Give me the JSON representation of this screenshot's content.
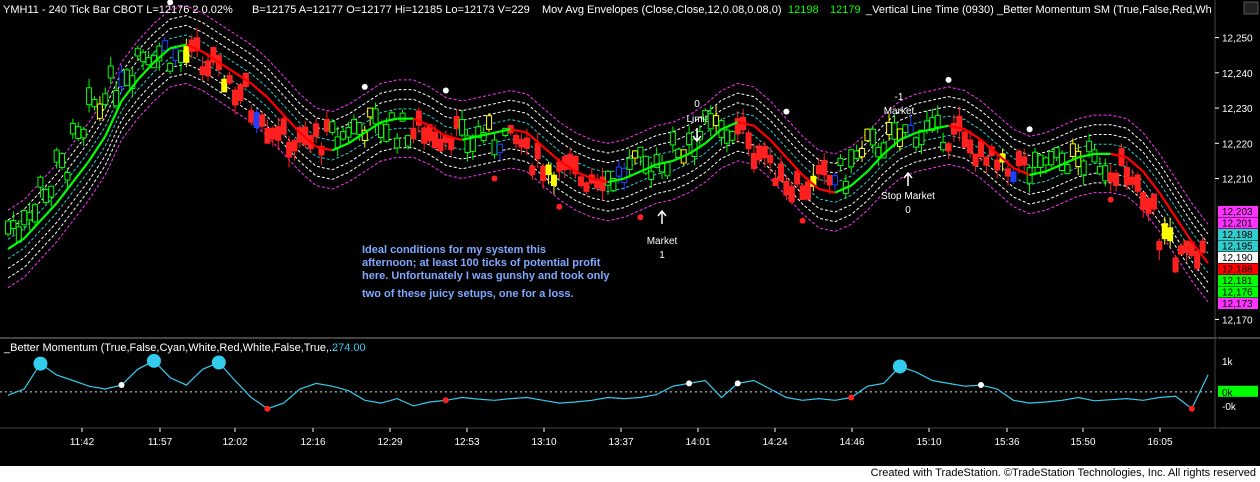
{
  "colors": {
    "background": "#000000",
    "up_candle": "#00ff00",
    "down_candle": "#ff2020",
    "yellow_candle": "#ffff00",
    "blue_candle": "#2040ff",
    "envelope_outer": "#ff33ff",
    "envelope_inner": "#ffffff",
    "envelope_mid": "#33cccc",
    "ma_up": "#00ff00",
    "ma_down": "#ff0000",
    "momentum": "#33ccee",
    "annotation": "#7fa9ff"
  },
  "header": {
    "symbol": "YMH11 - 240 Tick Bar  CBOT  L=12176  2   0.02%",
    "quote": "B=12175  A=12177  O=12177  Hi=12185  Lo=12173  V=229",
    "indicator": "Mov Avg Envelopes (Close,Close,12,0.08,0.08,0)",
    "ind_value_1": "12198",
    "ind_value_2": "12179",
    "vertical_line": "_Vertical Line Time (0930)",
    "momentum_sm": "_Better Momentum SM (True,False,Red,Wh"
  },
  "subpanel": {
    "title": "_Better Momentum (True,False,Cyan,White,Red,White,False,True,...",
    "value": "274.00",
    "axis_labels": [
      "1k",
      "0k",
      "-0k"
    ]
  },
  "price_axis": {
    "labels": [
      "12,250",
      "12,240",
      "12,230",
      "12,220",
      "12,210",
      "12,170"
    ],
    "tags": [
      {
        "text": "12,203",
        "color": "#ff33ff"
      },
      {
        "text": "12,201",
        "color": "#ff33ff"
      },
      {
        "text": "12,198",
        "color": "#33cccc"
      },
      {
        "text": "12,195",
        "color": "#33cccc"
      },
      {
        "text": "12,190",
        "color": "#ffffff"
      },
      {
        "text": "12,188",
        "color": "#ff0000"
      },
      {
        "text": "12,181",
        "color": "#00ff00"
      },
      {
        "text": "12,176",
        "color": "#00ff00"
      },
      {
        "text": "12,173",
        "color": "#ff33ff"
      }
    ]
  },
  "annotations": {
    "note_lines": [
      "Ideal conditions for my system this",
      "afternoon; at least 100 ticks of potential profit",
      "here. Unfortunately I was gunshy and took only",
      "two of these juicy setups, one for a loss."
    ],
    "market1": [
      "Market",
      "1"
    ],
    "limit0": [
      "0",
      "Limit"
    ],
    "market_minus1": [
      "-1",
      "Market"
    ],
    "stop_market": [
      "Stop Market",
      "0"
    ]
  },
  "footer": "Created with TradeStation. ©TradeStation Technologies, Inc. All rights reserved",
  "chart_data": {
    "type": "line",
    "x_labels": [
      "11:42",
      "11:57",
      "12:02",
      "12:16",
      "12:29",
      "12:53",
      "13:10",
      "13:37",
      "14:01",
      "14:24",
      "14:46",
      "15:10",
      "15:36",
      "15:50",
      "16:05"
    ],
    "ylim": [
      12167,
      12255
    ],
    "series": [
      {
        "name": "Mov Avg Envelopes",
        "values": [
          12190,
          12193,
          12198,
          12203,
          12209,
          12215,
          12222,
          12232,
          12238,
          12243,
          12247,
          12248,
          12246,
          12243,
          12240,
          12237,
          12233,
          12228,
          12223,
          12219,
          12218,
          12220,
          12223,
          12226,
          12227,
          12227,
          12225,
          12222,
          12221,
          12222,
          12223,
          12224,
          12223,
          12219,
          12215,
          12212,
          12210,
          12209,
          12210,
          12212,
          12214,
          12215,
          12217,
          12220,
          12224,
          12226,
          12225,
          12221,
          12216,
          12211,
          12207,
          12206,
          12208,
          12212,
          12217,
          12221,
          12223,
          12224,
          12225,
          12224,
          12221,
          12217,
          12213,
          12211,
          12212,
          12214,
          12216,
          12217,
          12217,
          12216,
          12212,
          12206,
          12199,
          12192,
          12186
        ]
      }
    ],
    "momentum_values": [
      -60,
      50,
      500,
      300,
      200,
      100,
      50,
      120,
      400,
      550,
      250,
      120,
      400,
      520,
      200,
      -100,
      -300,
      -200,
      50,
      150,
      100,
      20,
      -150,
      -200,
      -120,
      -250,
      -180,
      -150,
      -100,
      -130,
      -150,
      -120,
      -100,
      -150,
      -200,
      -180,
      -150,
      -100,
      -120,
      -100,
      -50,
      100,
      150,
      200,
      -100,
      150,
      200,
      50,
      -100,
      -150,
      -120,
      -150,
      -100,
      100,
      150,
      450,
      350,
      200,
      150,
      100,
      120,
      50,
      -150,
      -200,
      -180,
      -150,
      -100,
      -160,
      -140,
      -120,
      -150,
      -100,
      -80,
      -300,
      300
    ]
  }
}
